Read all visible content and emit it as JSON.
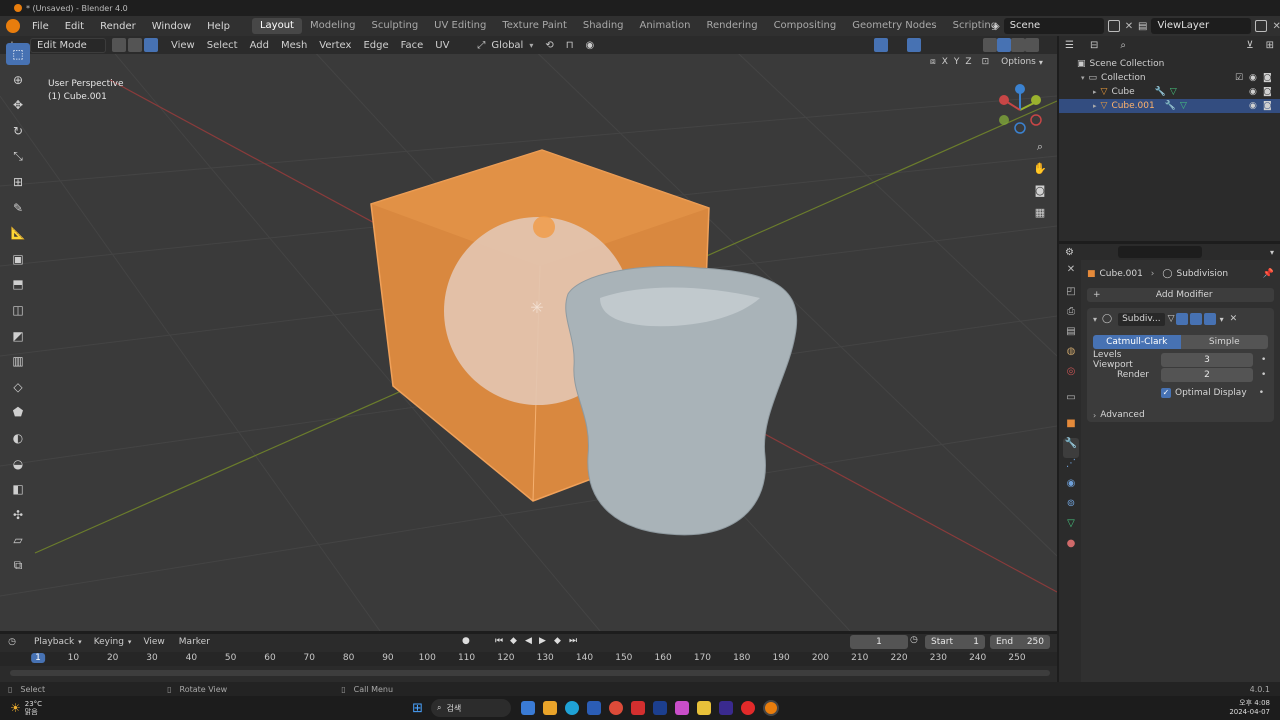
{
  "window": {
    "title": "* (Unsaved) - Blender 4.0"
  },
  "menubar": {
    "items": [
      "File",
      "Edit",
      "Render",
      "Window",
      "Help"
    ],
    "workspaces": [
      "Layout",
      "Modeling",
      "Sculpting",
      "UV Editing",
      "Texture Paint",
      "Shading",
      "Animation",
      "Rendering",
      "Compositing",
      "Geometry Nodes",
      "Scripting"
    ],
    "active_workspace": "Layout",
    "add_tab": "+",
    "scene": "Scene",
    "view_layer": "ViewLayer"
  },
  "viewport": {
    "mode": "Edit Mode",
    "menus": [
      "View",
      "Select",
      "Add",
      "Mesh",
      "Vertex",
      "Edge",
      "Face",
      "UV"
    ],
    "orientation": "Global",
    "overlay_text_1": "User Perspective",
    "overlay_text_2": "(1) Cube.001",
    "options_label": "Options",
    "axis_x": "X",
    "axis_y": "Y",
    "axis_z": "Z"
  },
  "outliner": {
    "root": "Scene Collection",
    "collection": "Collection",
    "items": [
      {
        "name": "Cube",
        "selected": false
      },
      {
        "name": "Cube.001",
        "selected": true
      }
    ]
  },
  "properties": {
    "breadcrumb_object": "Cube.001",
    "breadcrumb_modifier": "Subdivision",
    "add_modifier": "Add Modifier",
    "modifier_name": "Subdiv...",
    "tab_catmull": "Catmull-Clark",
    "tab_simple": "Simple",
    "levels_viewport_label": "Levels Viewport",
    "levels_viewport_value": "3",
    "render_label": "Render",
    "render_value": "2",
    "optimal_display_label": "Optimal Display",
    "optimal_display_checked": true,
    "advanced_label": "Advanced"
  },
  "timeline": {
    "menus": [
      "Playback",
      "Keying",
      "View",
      "Marker"
    ],
    "current_frame": "1",
    "start_label": "Start",
    "start_value": "1",
    "end_label": "End",
    "end_value": "250",
    "ruler": [
      "1",
      "10",
      "20",
      "30",
      "40",
      "50",
      "60",
      "70",
      "80",
      "90",
      "100",
      "110",
      "120",
      "130",
      "140",
      "150",
      "160",
      "170",
      "180",
      "190",
      "200",
      "210",
      "220",
      "230",
      "240",
      "250"
    ]
  },
  "statusbar": {
    "select": "Select",
    "rotate": "Rotate View",
    "call_menu": "Call Menu",
    "version": "4.0.1"
  },
  "taskbar": {
    "weather_temp": "23°C",
    "weather_text": "맑음",
    "search_text": "검색",
    "time": "오후 4:08",
    "date": "2024-04-07"
  },
  "colors": {
    "accent_blue": "#4772b3",
    "selection_orange": "#e08a3a",
    "viewport_bg": "#3a3a3a",
    "panel_bg": "#2b2b2b"
  }
}
